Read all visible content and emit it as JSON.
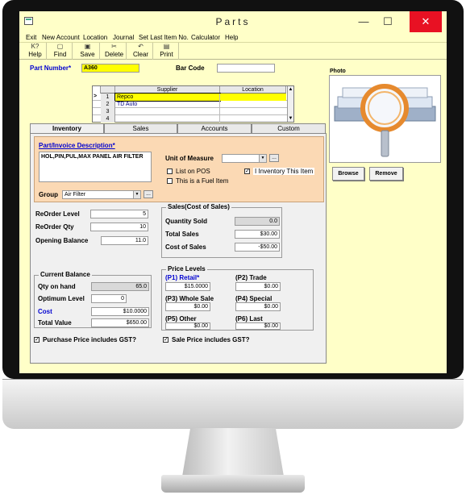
{
  "window": {
    "title": "Parts",
    "min": "—",
    "max": "☐",
    "close": "✕"
  },
  "menu": [
    "Exit",
    "New Account",
    "Location",
    "Journal",
    "Set Last Item No.",
    "Calculator",
    "Help"
  ],
  "toolbar": [
    {
      "label": "Help",
      "icon": "K?"
    },
    {
      "label": "Find",
      "icon": "▢"
    },
    {
      "label": "Save",
      "icon": "▣"
    },
    {
      "label": "Delete",
      "icon": "✂"
    },
    {
      "label": "Clear",
      "icon": "↶"
    },
    {
      "label": "Print",
      "icon": "▤"
    }
  ],
  "header": {
    "part_number_label": "Part Number*",
    "part_number_value": "A360",
    "bar_code_label": "Bar Code",
    "bar_code_value": ""
  },
  "supplier_grid": {
    "columns": [
      "Supplier",
      "Location"
    ],
    "pointer": ">",
    "rows": [
      {
        "num": "1",
        "supplier": "Repco",
        "location": ""
      },
      {
        "num": "2",
        "supplier": "TD Auto",
        "location": ""
      },
      {
        "num": "3",
        "supplier": "",
        "location": ""
      },
      {
        "num": "4",
        "supplier": "",
        "location": ""
      }
    ]
  },
  "tabs": [
    "Inventory",
    "Sales",
    "Accounts",
    "Custom"
  ],
  "inventory": {
    "desc_label": "Part/Invoice Description*",
    "desc_value": "HOL,PIN,PUL,MAX PANEL AIR FILTER",
    "uom_label": "Unit of Measure",
    "uom_value": "",
    "list_on_pos": "List on POS",
    "inventory_item": "I Inventory This Item",
    "fuel_item": "This is a Fuel Item",
    "group_label": "Group",
    "group_value": "Air Filter",
    "reorder_level_label": "ReOrder Level",
    "reorder_level": "5",
    "reorder_qty_label": "ReOrder Qty",
    "reorder_qty": "10",
    "opening_balance_label": "Opening Balance",
    "opening_balance": "11.0",
    "sales_title": "Sales(Cost of Sales)",
    "qty_sold_label": "Quantity Sold",
    "qty_sold": "0.0",
    "total_sales_label": "Total Sales",
    "total_sales": "$30.00",
    "cost_of_sales_label": "Cost of Sales",
    "cost_of_sales": "-$50.00",
    "balance_title": "Current Balance",
    "qty_on_hand_label": "Qty on hand",
    "qty_on_hand": "65.0",
    "optimum_label": "Optimum Level",
    "optimum": "0",
    "cost_label": "Cost",
    "cost": "$10.0000",
    "total_value_label": "Total Value",
    "total_value": "$650.00",
    "price_title": "Price Levels",
    "p1_label": "(P1) Retail*",
    "p1": "$15.0000",
    "p2_label": "(P2) Trade",
    "p2": "$0.00",
    "p3_label": "(P3) Whole Sale",
    "p3": "$0.00",
    "p4_label": "(P4) Special",
    "p4": "$0.00",
    "p5_label": "(P5) Other",
    "p5": "$0.00",
    "p6_label": "(P6) Last",
    "p6": "$0.00",
    "purchase_gst": "Purchase Price includes GST?",
    "sale_gst": "Sale Price includes GST?",
    "checkmark": "✓",
    "ellipsis": "...",
    "dd": "▼"
  },
  "photo": {
    "label": "Photo",
    "browse": "Browse",
    "remove": "Remove"
  },
  "colors": {
    "title_bg": "#ffffc8",
    "close_red": "#e81123",
    "desc_bg": "#fbd9b4",
    "highlight": "#ffff00"
  }
}
